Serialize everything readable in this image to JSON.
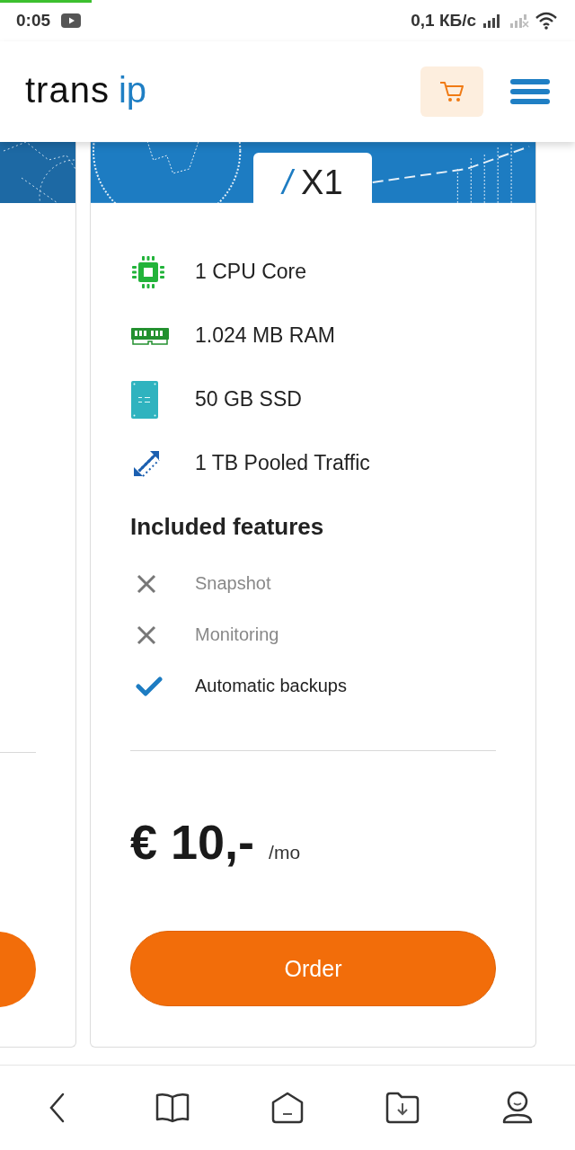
{
  "status_bar": {
    "time": "0:05",
    "speed": "0,1 КБ/с"
  },
  "header": {
    "logo": {
      "name": "trans",
      "suffix": "ip"
    }
  },
  "plan": {
    "prefix": "/",
    "name": "X1",
    "specs": [
      {
        "kind": "cpu",
        "text": "1 CPU Core"
      },
      {
        "kind": "ram",
        "text": "1.024 MB RAM"
      },
      {
        "kind": "ssd",
        "text": "50 GB SSD"
      },
      {
        "kind": "traffic",
        "text": "1 TB Pooled Traffic"
      }
    ],
    "features_title": "Included features",
    "features": [
      {
        "label": "Snapshot",
        "included": false
      },
      {
        "label": "Monitoring",
        "included": false
      },
      {
        "label": "Automatic backups",
        "included": true
      }
    ],
    "price": "€ 10,-",
    "period": "/mo",
    "order_button": "Order"
  },
  "bottom_nav": [
    {
      "kind": "back"
    },
    {
      "kind": "book"
    },
    {
      "kind": "home"
    },
    {
      "kind": "downloads"
    },
    {
      "kind": "profile"
    }
  ]
}
